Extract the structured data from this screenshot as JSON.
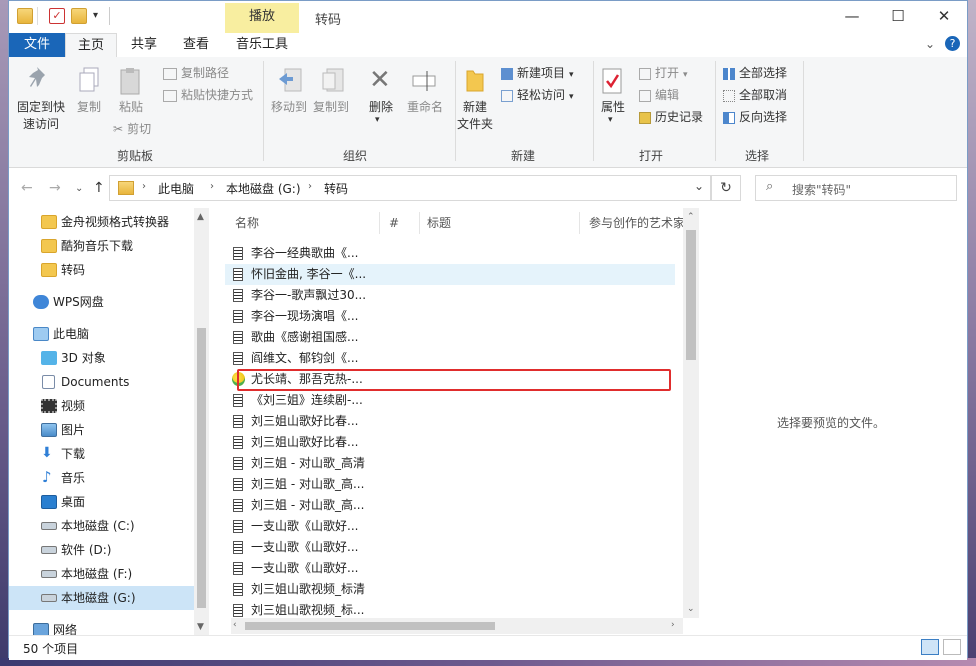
{
  "window": {
    "title": "转码",
    "contextual_tab": "播放",
    "min_glyph": "—",
    "max_glyph": "☐",
    "close_glyph": "✕"
  },
  "tabs": {
    "file": "文件",
    "home": "主页",
    "share": "共享",
    "view": "查看",
    "music_tools": "音乐工具"
  },
  "ribbon": {
    "clipboard": {
      "pin_line1": "固定到快",
      "pin_line2": "速访问",
      "copy": "复制",
      "paste": "粘贴",
      "copy_path": "复制路径",
      "paste_shortcut": "粘贴快捷方式",
      "cut": "剪切",
      "group": "剪贴板"
    },
    "organize": {
      "move_to": "移动到",
      "copy_to": "复制到",
      "delete": "删除",
      "rename": "重命名",
      "group": "组织"
    },
    "new": {
      "new_folder_line1": "新建",
      "new_folder_line2": "文件夹",
      "new_item": "新建项目",
      "easy_access": "轻松访问",
      "group": "新建"
    },
    "open": {
      "properties": "属性",
      "open": "打开",
      "edit": "编辑",
      "history": "历史记录",
      "group": "打开"
    },
    "select": {
      "select_all": "全部选择",
      "select_none": "全部取消",
      "invert": "反向选择",
      "group": "选择"
    }
  },
  "address": {
    "crumbs": [
      "此电脑",
      "本地磁盘 (G:)",
      "转码"
    ],
    "search_placeholder": "搜索\"转码\""
  },
  "nav": {
    "items": [
      {
        "label": "金舟视频格式转换器",
        "icon": "folder-icon"
      },
      {
        "label": "酷狗音乐下载",
        "icon": "folder-icon"
      },
      {
        "label": "转码",
        "icon": "folder-icon"
      },
      {
        "label": "WPS网盘",
        "icon": "cloud-icon"
      },
      {
        "label": "此电脑",
        "icon": "computer-icon"
      },
      {
        "label": "3D 对象",
        "icon": "cube-icon"
      },
      {
        "label": "Documents",
        "icon": "document-icon"
      },
      {
        "label": "视频",
        "icon": "video-icon"
      },
      {
        "label": "图片",
        "icon": "picture-icon"
      },
      {
        "label": "下载",
        "icon": "download-icon"
      },
      {
        "label": "音乐",
        "icon": "music-icon"
      },
      {
        "label": "桌面",
        "icon": "desktop-icon"
      },
      {
        "label": "本地磁盘 (C:)",
        "icon": "drive-icon"
      },
      {
        "label": "软件 (D:)",
        "icon": "drive-icon"
      },
      {
        "label": "本地磁盘 (F:)",
        "icon": "drive-icon"
      },
      {
        "label": "本地磁盘 (G:)",
        "icon": "drive-icon"
      },
      {
        "label": "网络",
        "icon": "network-icon"
      }
    ]
  },
  "list": {
    "columns": [
      "名称",
      "#",
      "标题",
      "参与创作的艺术家"
    ],
    "files": [
      "李谷一经典歌曲《...",
      "怀旧金曲, 李谷一《...",
      "李谷一-歌声飘过30...",
      "李谷一现场演唱《...",
      "歌曲《感谢祖国感...",
      "阎维文、郁钧剑《...",
      "尤长靖、那吾克热-...",
      "《刘三姐》连续剧-...",
      "刘三姐山歌好比春...",
      "刘三姐山歌好比春...",
      "刘三姐 - 对山歌_高清",
      "刘三姐 - 对山歌_高...",
      "刘三姐 - 对山歌_高...",
      "一支山歌《山歌好...",
      "一支山歌《山歌好...",
      "一支山歌《山歌好...",
      "刘三姐山歌视频_标清",
      "刘三姐山歌视频_标..."
    ]
  },
  "preview": {
    "message": "选择要预览的文件。"
  },
  "status": {
    "count": "50 个项目"
  },
  "colors": {
    "accent": "#1a66b8",
    "highlight_border": "#e02d2d",
    "selected_bg": "#cce4f7"
  }
}
